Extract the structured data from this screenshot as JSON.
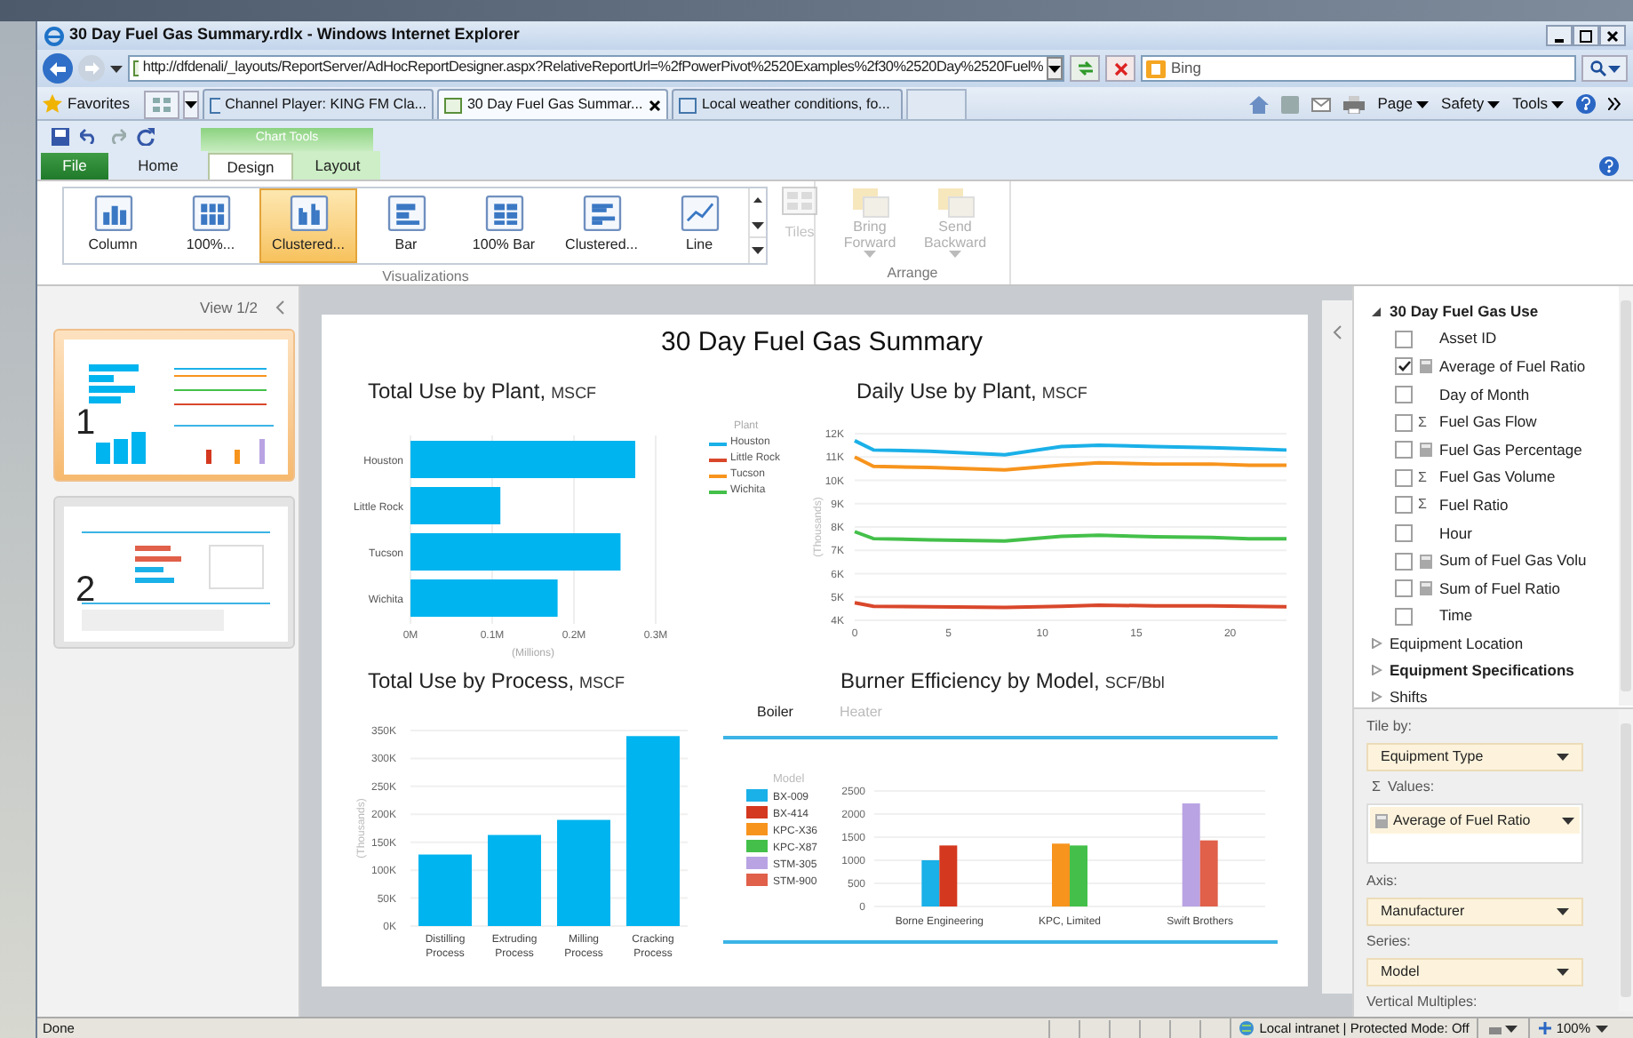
{
  "window": {
    "title": "30 Day Fuel Gas Summary.rdlx - Windows Internet Explorer"
  },
  "address_bar": {
    "url": "http://dfdenali/_layouts/ReportServer/AdHocReportDesigner.aspx?RelativeReportUrl=%2fPowerPivot%2520Examples%2f30%2520Day%2520Fuel%",
    "search": {
      "placeholder": "Bing"
    }
  },
  "favorites_bar": {
    "favorites": "Favorites",
    "tabs": [
      {
        "label": "Channel Player: KING FM Cla...",
        "selected": false
      },
      {
        "label": "30 Day Fuel Gas Summar...",
        "selected": true
      },
      {
        "label": "Local weather conditions, fo...",
        "selected": false
      }
    ],
    "commands": [
      "Page",
      "Safety",
      "Tools"
    ]
  },
  "ribbon": {
    "contextual_group": "Chart Tools",
    "tabs": [
      {
        "label": "File",
        "kind": "file",
        "selected": false
      },
      {
        "label": "Home",
        "kind": "plain",
        "selected": false
      },
      {
        "label": "Design",
        "kind": "contextual",
        "selected": true
      },
      {
        "label": "Layout",
        "kind": "contextual",
        "selected": false
      }
    ],
    "gallery": [
      {
        "label": "Column",
        "kind": "column",
        "selected": false
      },
      {
        "label": "100%...",
        "kind": "stacked_column",
        "selected": false
      },
      {
        "label": "Clustered...",
        "kind": "clustered_column",
        "selected": true
      },
      {
        "label": "Bar",
        "kind": "bar",
        "selected": false
      },
      {
        "label": "100% Bar",
        "kind": "stacked_bar",
        "selected": false
      },
      {
        "label": "Clustered...",
        "kind": "clustered_bar",
        "selected": false
      },
      {
        "label": "Line",
        "kind": "line",
        "selected": false
      }
    ],
    "tiles": {
      "label": "Tiles",
      "disabled": true
    },
    "arrange": [
      {
        "label": "Bring Forward",
        "disabled": true
      },
      {
        "label": "Send Backward",
        "disabled": true
      }
    ],
    "group_labels": [
      "Visualizations",
      "Arrange"
    ]
  },
  "views": {
    "label": "View 1/2",
    "thumbnails": [
      {
        "number": "1",
        "selected": true
      },
      {
        "number": "2",
        "selected": false
      }
    ]
  },
  "report": {
    "title": "30 Day Fuel Gas Summary",
    "charts": [
      {
        "title": "Total Use by Plant,",
        "unit": "MSCF",
        "chart_data": {
          "type": "bar",
          "orientation": "horizontal",
          "grid": true,
          "categories": [
            "Houston",
            "Little Rock",
            "Tucson",
            "Wichita"
          ],
          "values": [
            0.275,
            0.11,
            0.257,
            0.18
          ],
          "xlabel": "(Millions)",
          "xlim": [
            0,
            0.3
          ],
          "xticks": [
            {
              "value": 0,
              "label": "0M"
            },
            {
              "value": 0.1,
              "label": "0.1M"
            },
            {
              "value": 0.2,
              "label": "0.2M"
            },
            {
              "value": 0.3,
              "label": "0.3M"
            }
          ]
        }
      },
      {
        "title": "Daily Use by Plant,",
        "unit": "MSCF",
        "legend_title": "Plant",
        "chart_data": {
          "type": "line",
          "grid": true,
          "legend": "left",
          "x": [
            0,
            1,
            4,
            8,
            11,
            13,
            16,
            19,
            21,
            23
          ],
          "series": [
            {
              "name": "Houston",
              "color": "#1ab0e8",
              "values": [
                11.7,
                11.3,
                11.25,
                11.1,
                11.45,
                11.5,
                11.45,
                11.4,
                11.35,
                11.3
              ]
            },
            {
              "name": "Little Rock",
              "color": "#d9472b",
              "values": [
                4.75,
                4.6,
                4.58,
                4.55,
                4.6,
                4.65,
                4.62,
                4.62,
                4.6,
                4.58
              ]
            },
            {
              "name": "Tucson",
              "color": "#f7941d",
              "values": [
                11.0,
                10.6,
                10.55,
                10.45,
                10.65,
                10.75,
                10.7,
                10.7,
                10.65,
                10.65
              ]
            },
            {
              "name": "Wichita",
              "color": "#44c04a",
              "values": [
                7.8,
                7.5,
                7.45,
                7.4,
                7.6,
                7.65,
                7.58,
                7.55,
                7.5,
                7.5
              ]
            }
          ],
          "ylabel": "(Thousands)",
          "xlim": [
            0,
            23
          ],
          "ylim": [
            4,
            12
          ],
          "xticks": [
            0,
            5,
            10,
            15,
            20
          ],
          "yticks": [
            {
              "value": 4,
              "label": "4K"
            },
            {
              "value": 5,
              "label": "5K"
            },
            {
              "value": 6,
              "label": "6K"
            },
            {
              "value": 7,
              "label": "7K"
            },
            {
              "value": 8,
              "label": "8K"
            },
            {
              "value": 9,
              "label": "9K"
            },
            {
              "value": 10,
              "label": "10K"
            },
            {
              "value": 11,
              "label": "11K"
            },
            {
              "value": 12,
              "label": "12K"
            }
          ]
        }
      },
      {
        "title": "Total Use by Process,",
        "unit": "MSCF",
        "chart_data": {
          "type": "bar",
          "orientation": "vertical",
          "grid": true,
          "categories": [
            "Distilling Process",
            "Extruding Process",
            "Milling Process",
            "Cracking Process"
          ],
          "values": [
            128,
            163,
            190,
            340
          ],
          "ylabel": "(Thousands)",
          "ylim": [
            0,
            350
          ],
          "yticks": [
            {
              "value": 0,
              "label": "0K"
            },
            {
              "value": 50,
              "label": "50K"
            },
            {
              "value": 100,
              "label": "100K"
            },
            {
              "value": 150,
              "label": "150K"
            },
            {
              "value": 200,
              "label": "200K"
            },
            {
              "value": 250,
              "label": "250K"
            },
            {
              "value": 300,
              "label": "300K"
            },
            {
              "value": 350,
              "label": "350K"
            }
          ]
        }
      },
      {
        "title": "Burner Efficiency by Model,",
        "unit": "SCF/Bbl",
        "tabs": [
          {
            "label": "Boiler",
            "selected": true
          },
          {
            "label": "Heater",
            "selected": false
          }
        ],
        "legend_title": "Model",
        "chart_data": {
          "type": "bar",
          "orientation": "vertical",
          "grid": true,
          "legend": "left",
          "categories": [
            "Borne Engineering",
            "KPC, Limited",
            "Swift Brothers"
          ],
          "series": [
            {
              "name": "BX-009",
              "color": "#1ab0e8",
              "values": [
                1000,
                null,
                null
              ]
            },
            {
              "name": "BX-414",
              "color": "#d4381f",
              "values": [
                1320,
                null,
                null
              ]
            },
            {
              "name": "KPC-X36",
              "color": "#f7941d",
              "values": [
                null,
                1360,
                null
              ]
            },
            {
              "name": "KPC-X87",
              "color": "#44c04a",
              "values": [
                null,
                1320,
                null
              ]
            },
            {
              "name": "STM-305",
              "color": "#b9a3e3",
              "values": [
                null,
                null,
                2230
              ]
            },
            {
              "name": "STM-900",
              "color": "#e0604a",
              "values": [
                null,
                null,
                1430
              ]
            }
          ],
          "ylim": [
            0,
            2500
          ],
          "yticks": [
            0,
            500,
            1000,
            1500,
            2000,
            2500
          ]
        }
      }
    ]
  },
  "field_list": {
    "tables": [
      {
        "name": "30 Day Fuel Gas Use",
        "expanded": true,
        "used": true,
        "children": [
          {
            "name": "Asset ID",
            "checked": false,
            "kind": "plain"
          },
          {
            "name": "Average of Fuel Ratio",
            "checked": true,
            "kind": "calculated"
          },
          {
            "name": "Day of Month",
            "checked": false,
            "kind": "plain"
          },
          {
            "name": "Fuel Gas Flow",
            "checked": false,
            "kind": "aggregate",
            "symbol": "Σ"
          },
          {
            "name": "Fuel Gas Percentage",
            "checked": false,
            "kind": "calculated"
          },
          {
            "name": "Fuel Gas Volume",
            "checked": false,
            "kind": "aggregate",
            "symbol": "Σ"
          },
          {
            "name": "Fuel Ratio",
            "checked": false,
            "kind": "aggregate",
            "symbol": "Σ"
          },
          {
            "name": "Hour",
            "checked": false,
            "kind": "plain"
          },
          {
            "name": "Sum of Fuel Gas Volu",
            "checked": false,
            "kind": "calculated"
          },
          {
            "name": "Sum of Fuel Ratio",
            "checked": false,
            "kind": "calculated"
          },
          {
            "name": "Time",
            "checked": false,
            "kind": "plain"
          }
        ]
      },
      {
        "name": "Equipment Location",
        "expanded": false,
        "used": false
      },
      {
        "name": "Equipment Specifications",
        "expanded": false,
        "used": true
      },
      {
        "name": "Shifts",
        "expanded": false,
        "used": false
      }
    ]
  },
  "wells": [
    {
      "label": "Tile by:",
      "kind": "dropdown",
      "value": "Equipment Type"
    },
    {
      "label": "Values:",
      "kind": "values",
      "symbol": "Σ",
      "items": [
        "Average of Fuel Ratio"
      ]
    },
    {
      "label": "Axis:",
      "kind": "dropdown",
      "value": "Manufacturer"
    },
    {
      "label": "Series:",
      "kind": "dropdown",
      "value": "Model"
    },
    {
      "label": "Vertical Multiples:",
      "kind": "heading"
    }
  ],
  "status_bar": {
    "text": "Done",
    "zone": "Local intranet | Protected Mode: Off",
    "zoom": "100%"
  }
}
